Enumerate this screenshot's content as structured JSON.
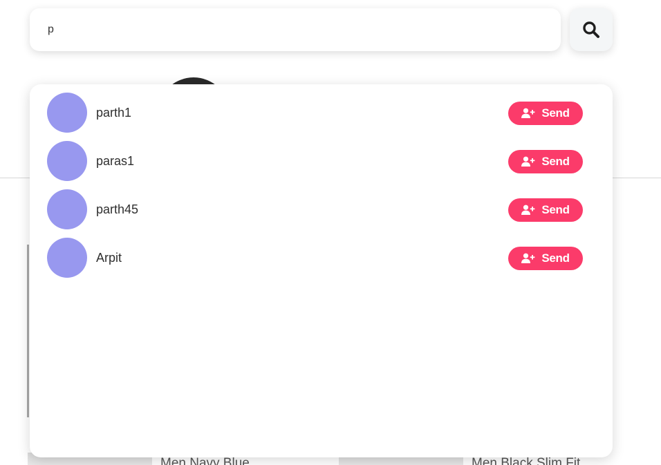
{
  "search": {
    "value": "p",
    "icon": "search-icon"
  },
  "results": [
    {
      "name": "parth1",
      "action_label": "Send",
      "action_icon": "user-plus-icon"
    },
    {
      "name": "paras1",
      "action_label": "Send",
      "action_icon": "user-plus-icon"
    },
    {
      "name": "parth45",
      "action_label": "Send",
      "action_icon": "user-plus-icon"
    },
    {
      "name": "Arpit",
      "action_label": "Send",
      "action_icon": "user-plus-icon"
    }
  ],
  "background_products": [
    {
      "name": "Men Navy Blue"
    },
    {
      "name": "Men Black Slim Fit"
    }
  ],
  "colors": {
    "avatar_placeholder": "#9898ef",
    "send_button": "#fb3b6a",
    "search_button_bg": "#f4f6f7"
  }
}
